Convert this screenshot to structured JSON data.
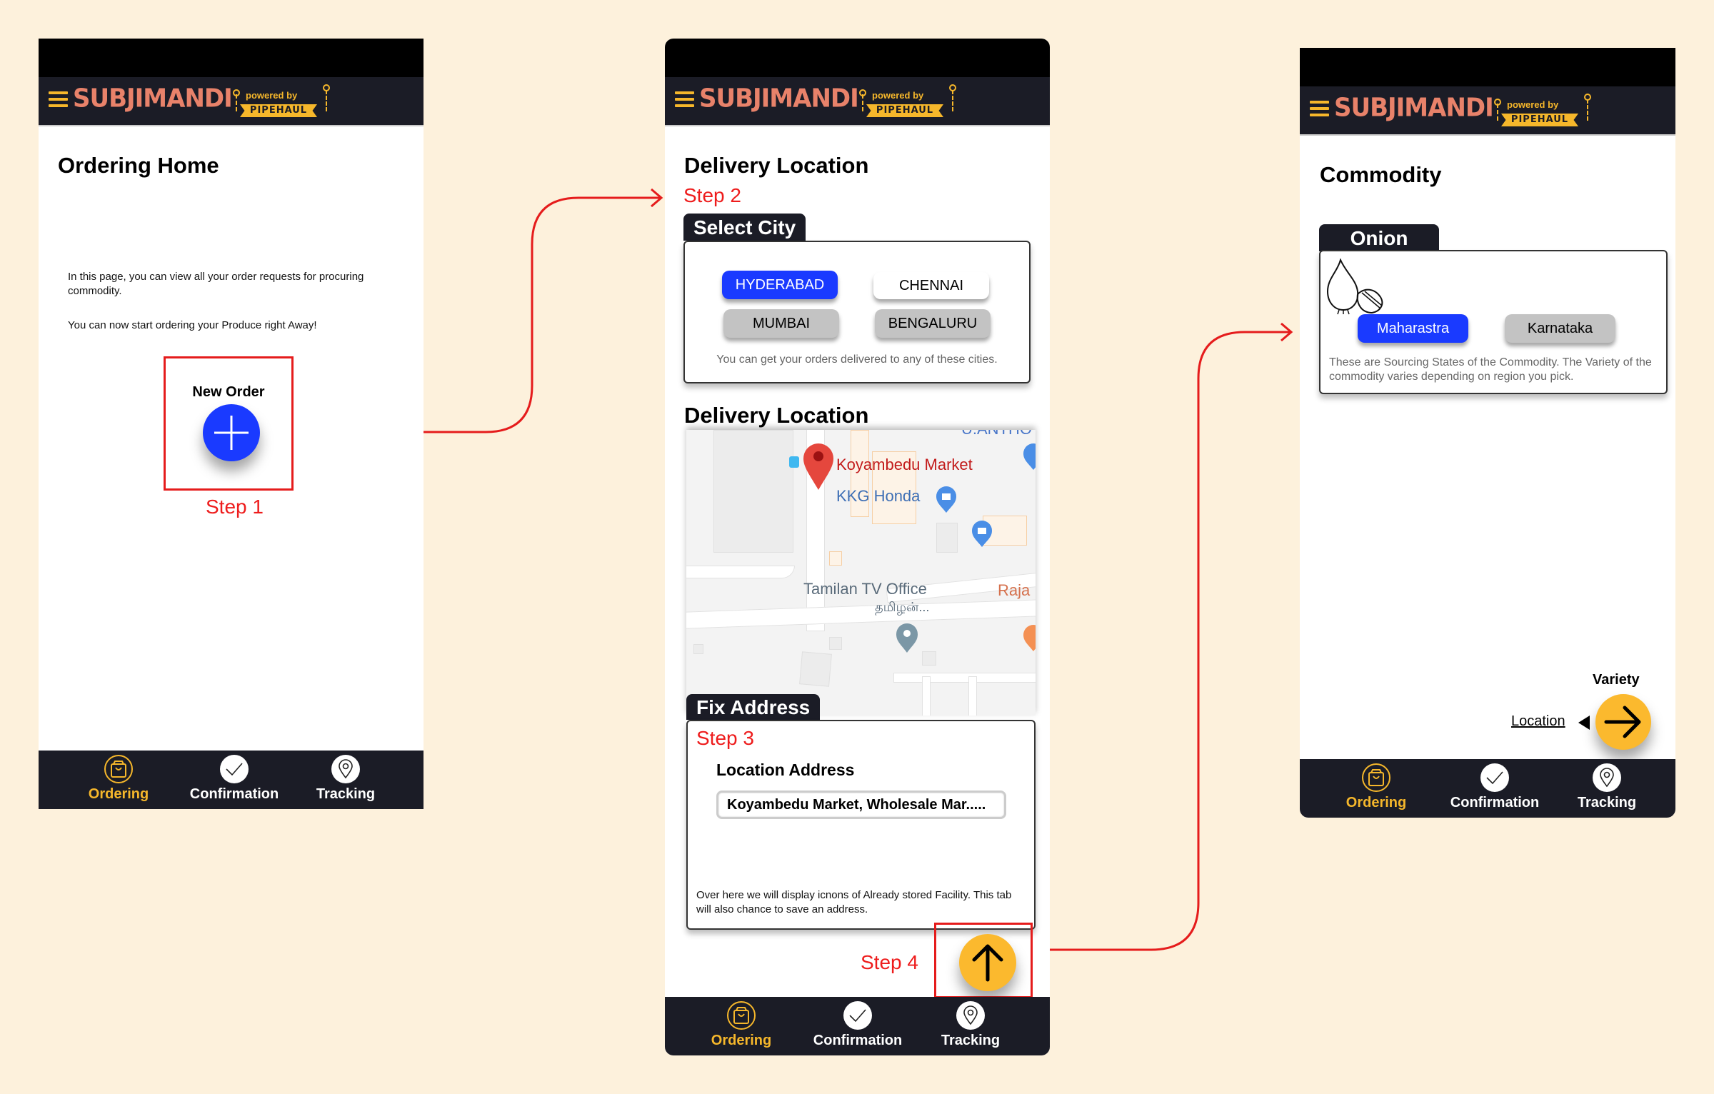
{
  "app": {
    "brand": "SUBJIMANDI",
    "powered_by": "powered by",
    "partner": "PIPEHAUL",
    "colors": {
      "background": "#fdf1dc",
      "appbar": "#1b1c26",
      "brand": "#e8826a",
      "accent": "#f6b72b",
      "primary_blue": "#1a3aff",
      "step_red": "#ee1c1c"
    }
  },
  "nav": {
    "items": [
      {
        "label": "Ordering",
        "icon": "shopping-bag-icon",
        "active": true
      },
      {
        "label": "Confirmation",
        "icon": "checkmark-icon",
        "active": false
      },
      {
        "label": "Tracking",
        "icon": "location-pin-icon",
        "active": false
      }
    ]
  },
  "screen1": {
    "title": "Ordering Home",
    "description": "In this page, you can view all your order requests for procuring commodity.",
    "cta_text": "You can now start ordering  your Produce right Away!",
    "new_order_label": "New Order",
    "new_order_icon": "plus-icon",
    "step": "Step 1"
  },
  "screen2": {
    "title": "Delivery Location",
    "step": "Step 2",
    "select_city": {
      "tab": "Select City",
      "cities": [
        {
          "label": "HYDERABAD",
          "state": "selected"
        },
        {
          "label": "CHENNAI",
          "state": "default"
        },
        {
          "label": "MUMBAI",
          "state": "disabled"
        },
        {
          "label": "BENGALURU",
          "state": "disabled"
        }
      ],
      "hint": "You can get your orders delivered to any of these cities."
    },
    "map_section_title": "Delivery Location",
    "map": {
      "pin_label": "Koyambedu Market",
      "places": [
        "KKG Honda",
        "Tamilan TV Office",
        "தமிழன்...",
        "Raja"
      ],
      "partial_label_top": "U.ANTHO"
    },
    "fix_address": {
      "tab": "Fix Address",
      "step": "Step 3",
      "field_label": "Location Address",
      "field_value": "Koyambedu Market, Wholesale Mar.....",
      "note": "Over here we will display icnons of Already stored Facility. This tab will also chance to save an address."
    },
    "next_step": "Step 4",
    "next_icon": "arrow-up-icon"
  },
  "screen3": {
    "title": "Commodity",
    "commodity_tab": "Onion",
    "commodity_icon": "onion-icon",
    "states": [
      {
        "label": "Maharastra",
        "state": "selected"
      },
      {
        "label": "Karnataka",
        "state": "disabled"
      }
    ],
    "hint": "These are Sourcing States of the Commodity. The Variety of the commodity varies depending on region you pick.",
    "next_label": "Variety",
    "back_link": "Location",
    "next_icon": "arrow-right-icon"
  }
}
